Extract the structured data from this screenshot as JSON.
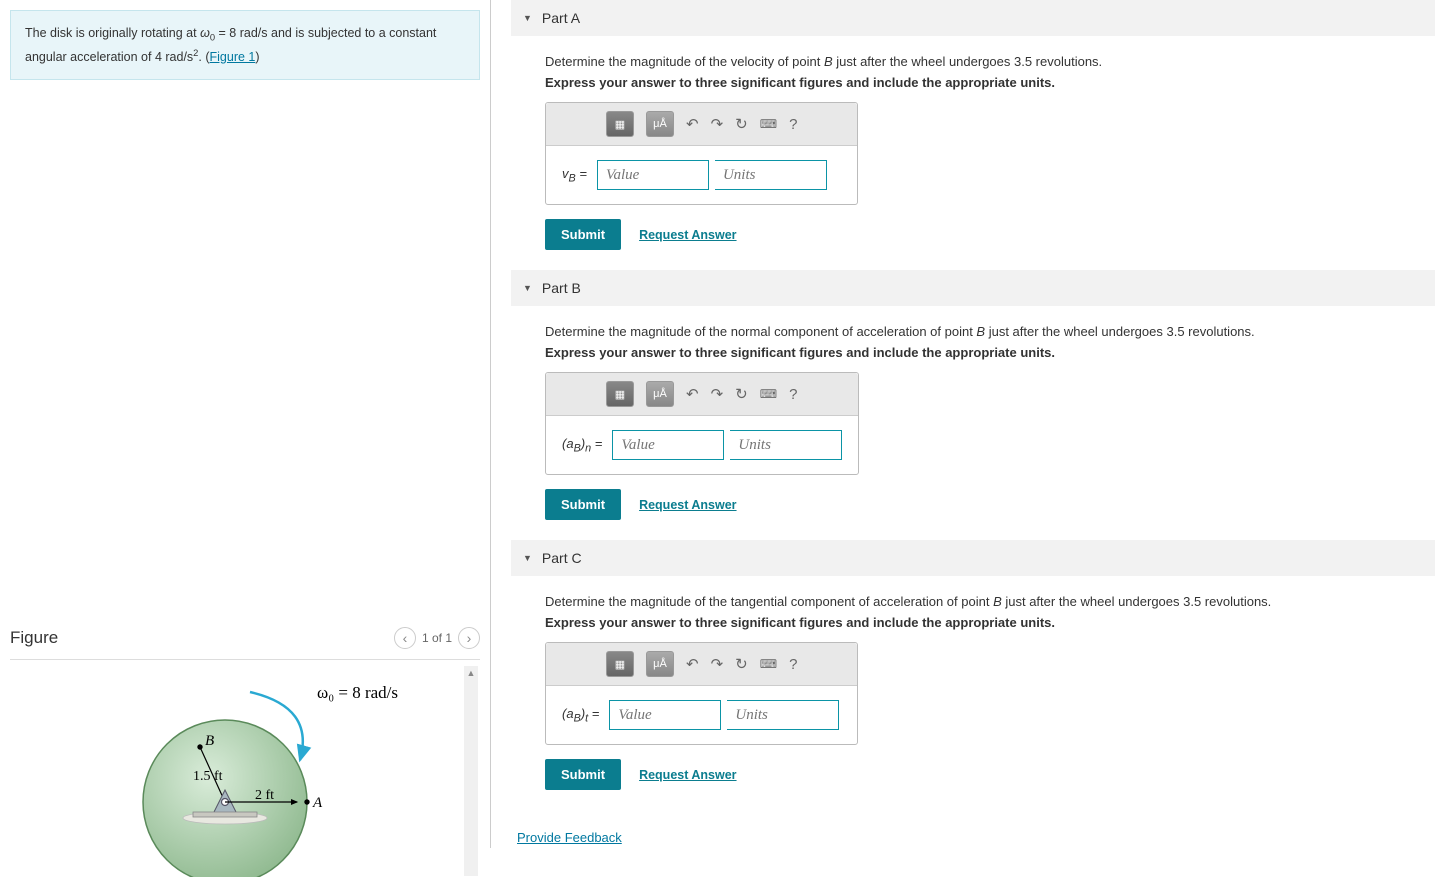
{
  "problem": {
    "text_prefix": "The disk is originally rotating at ",
    "omega_var": "ω",
    "omega_sub": "0",
    "omega_val": " = 8 rad/s",
    "text_mid": " and is subjected to a constant angular acceleration of ",
    "alpha_val": "4 rad/s",
    "alpha_sup": "2",
    "text_suffix": ". (",
    "figure_link": "Figure 1",
    "text_end": ")"
  },
  "figure": {
    "title": "Figure",
    "nav_label": "1 of 1",
    "omega_label": "ω₀ = 8 rad/s",
    "point_B": "B",
    "radius_B": "1.5 ft",
    "radius_A": "2 ft",
    "point_A": "A"
  },
  "parts": [
    {
      "title": "Part A",
      "question": "Determine the magnitude of the velocity of point B just after the wheel undergoes 3.5 revolutions.",
      "instruct": "Express your answer to three significant figures and include the appropriate units.",
      "var_label_html": "<i>v<sub>B</sub></i> =",
      "value_ph": "Value",
      "units_ph": "Units",
      "submit": "Submit",
      "request": "Request Answer"
    },
    {
      "title": "Part B",
      "question": "Determine the magnitude of the normal component of acceleration of point B just after the wheel undergoes 3.5 revolutions.",
      "instruct": "Express your answer to three significant figures and include the appropriate units.",
      "var_label_html": "(<i>a<sub>B</sub></i>)<i><sub>n</sub></i> =",
      "value_ph": "Value",
      "units_ph": "Units",
      "submit": "Submit",
      "request": "Request Answer"
    },
    {
      "title": "Part C",
      "question": "Determine the magnitude of the tangential component of acceleration of point B just after the wheel undergoes 3.5 revolutions.",
      "instruct": "Express your answer to three significant figures and include the appropriate units.",
      "var_label_html": "(<i>a<sub>B</sub></i>)<i><sub>t</sub></i> =",
      "value_ph": "Value",
      "units_ph": "Units",
      "submit": "Submit",
      "request": "Request Answer"
    }
  ],
  "toolbar": {
    "templates": "▦",
    "special": "μÅ",
    "undo": "↶",
    "redo": "↷",
    "reset": "↻",
    "keyboard": "⌨",
    "help": "?"
  },
  "feedback": "Provide Feedback"
}
